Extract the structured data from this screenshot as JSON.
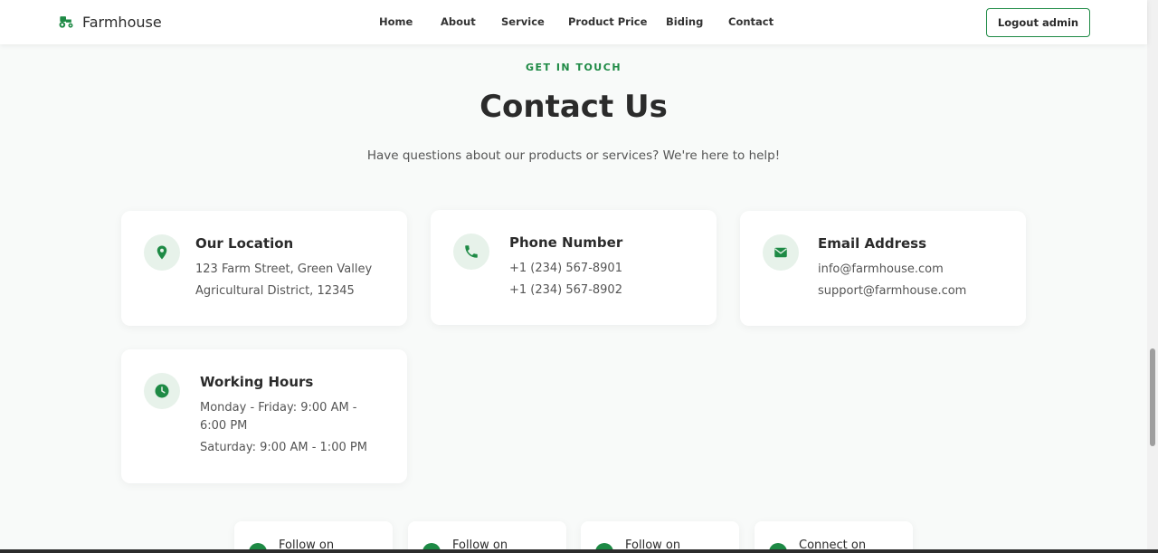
{
  "header": {
    "brand": "Farmhouse",
    "nav": [
      "Home",
      "About",
      "Service",
      "Product Price",
      "Biding",
      "Contact"
    ],
    "logout": "Logout admin"
  },
  "section": {
    "eyebrow": "GET IN TOUCH",
    "title": "Contact Us",
    "subtitle": "Have questions about our products or services? We're here to help!"
  },
  "cards": [
    {
      "icon": "map-pin-icon",
      "title": "Our Location",
      "lines": [
        "123 Farm Street, Green Valley",
        "Agricultural District, 12345"
      ]
    },
    {
      "icon": "phone-icon",
      "title": "Phone Number",
      "lines": [
        "+1 (234) 567-8901",
        "+1 (234) 567-8902"
      ]
    },
    {
      "icon": "envelope-icon",
      "title": "Email Address",
      "lines": [
        "info@farmhouse.com",
        "support@farmhouse.com"
      ]
    },
    {
      "icon": "clock-icon",
      "title": "Working Hours",
      "lines": [
        "Monday - Friday: 9:00 AM -",
        "6:00 PM",
        "Saturday: 9:00 AM - 1:00 PM"
      ]
    }
  ],
  "social": [
    "Follow on",
    "Follow on",
    "Follow on",
    "Connect on"
  ],
  "colors": {
    "accent": "#1e8a45",
    "icon_bg": "#e7f2ea",
    "page_bg": "#f8faf9"
  }
}
